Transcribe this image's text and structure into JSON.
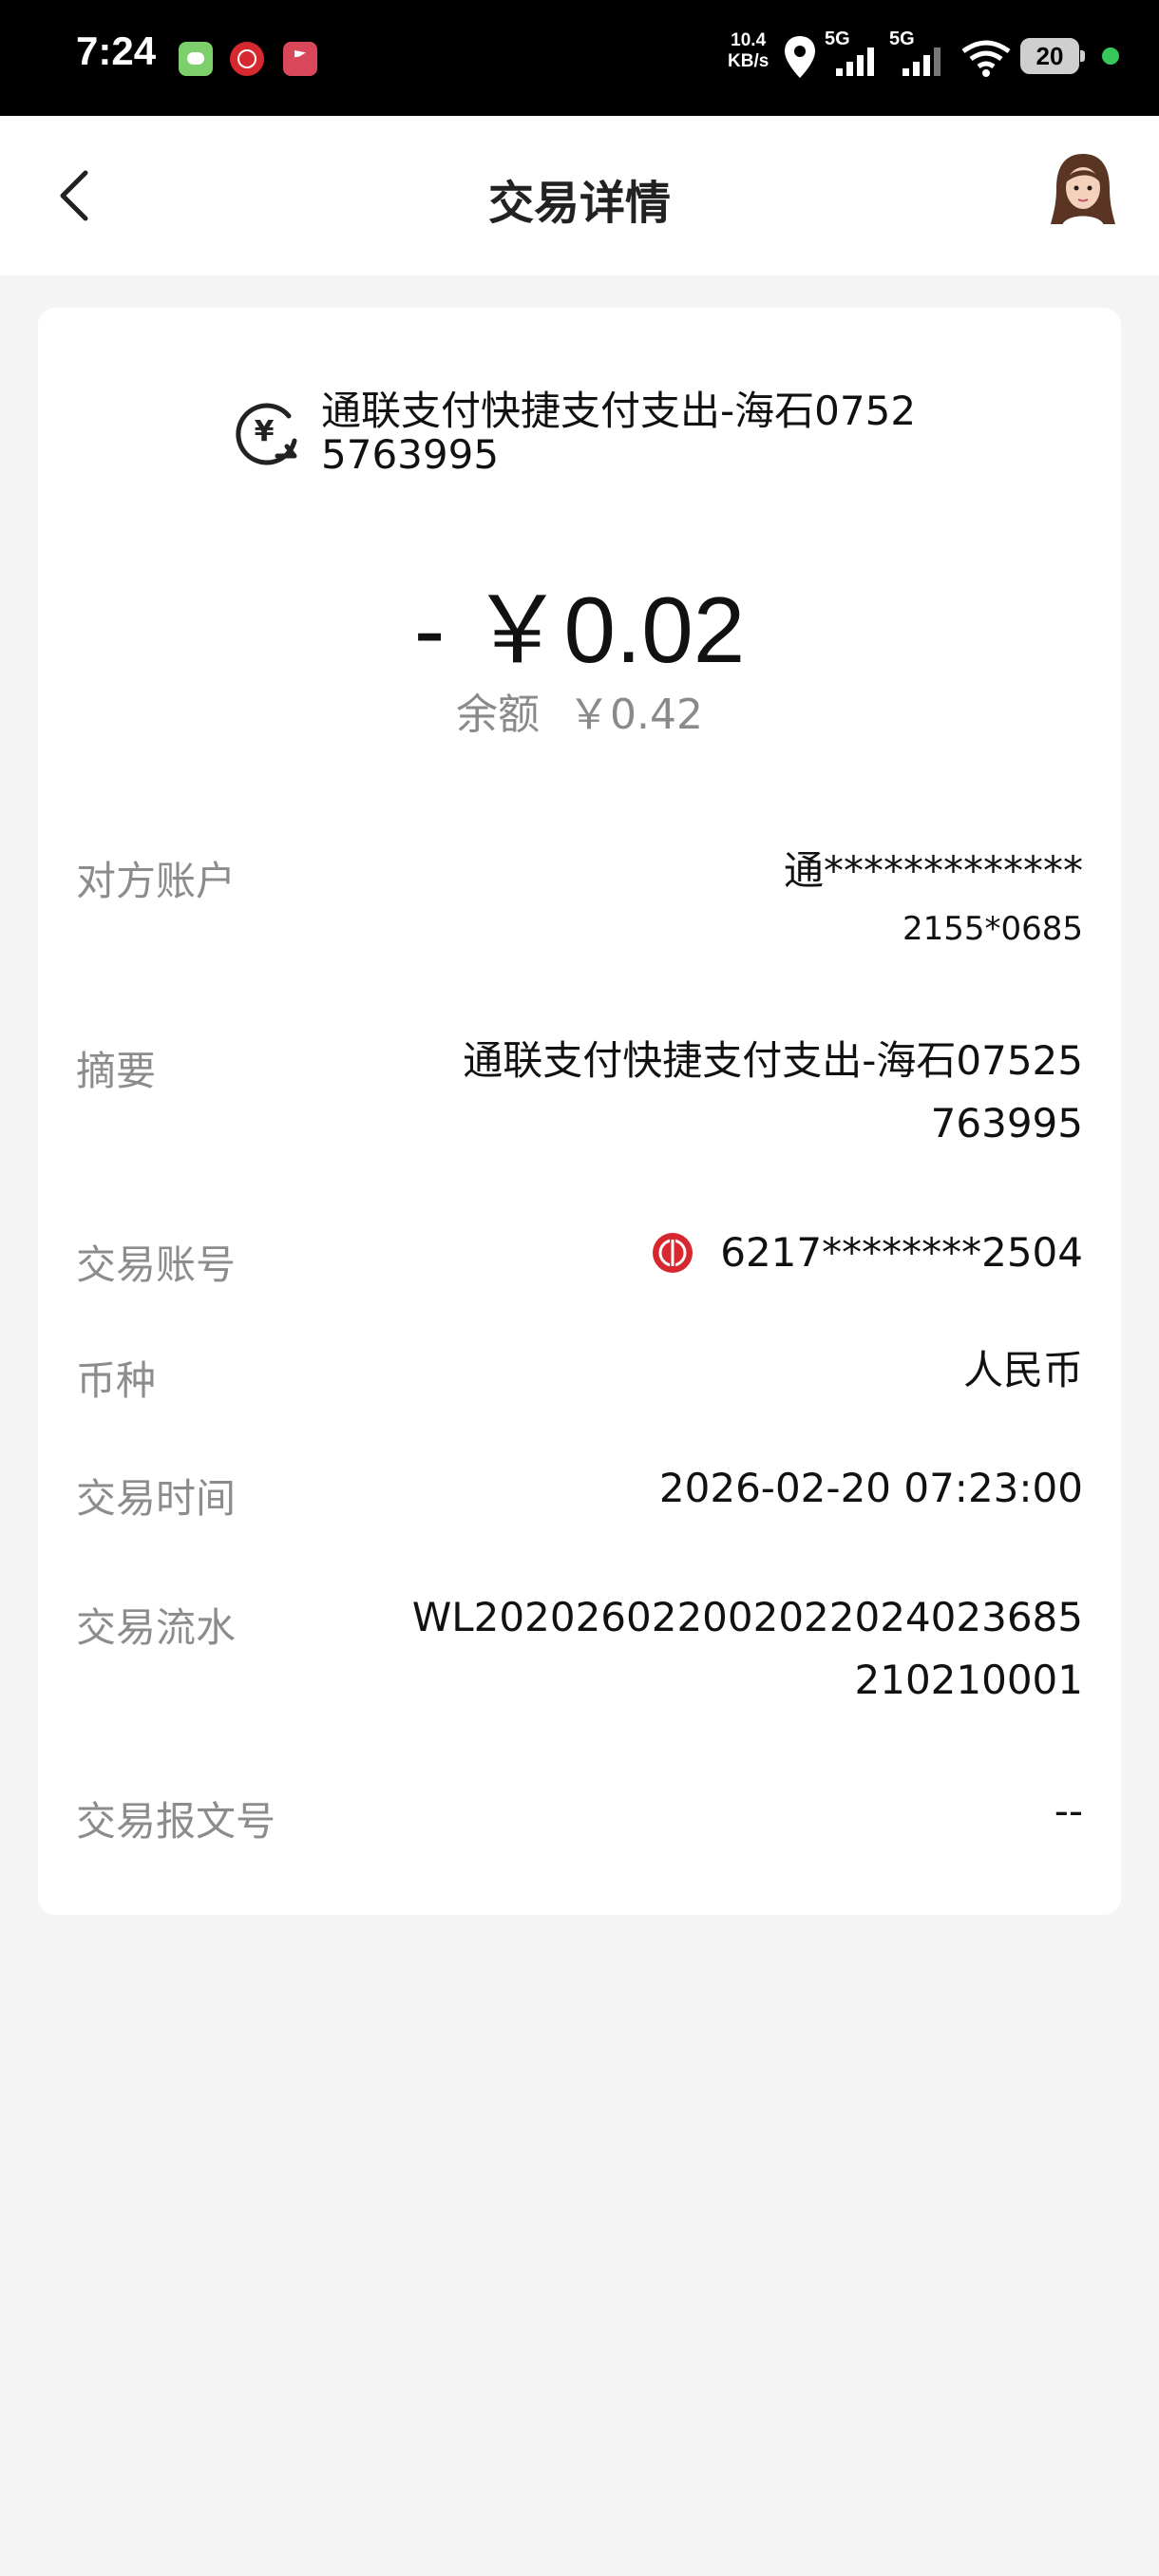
{
  "status_bar": {
    "time": "7:24",
    "net_speed_value": "10.4",
    "net_speed_unit": "KB/s",
    "signal1_label": "5G",
    "signal2_label": "5G",
    "battery": "20"
  },
  "nav": {
    "title": "交易详情"
  },
  "transaction": {
    "description": "通联支付快捷支付支出-海石07525763995",
    "amount": "- ￥0.02",
    "balance_label": "余额",
    "balance_value": "￥0.42"
  },
  "details": [
    {
      "label": "对方账户",
      "value_main": "通*************",
      "value_sub": "2155*0685"
    },
    {
      "label": "摘要",
      "value_line1": "通联支付快捷支付支出-海石07525",
      "value_line2": "763995"
    },
    {
      "label": "交易账号",
      "value": "6217********2504"
    },
    {
      "label": "币种",
      "value": "人民币"
    },
    {
      "label": "交易时间",
      "value": "2026-02-20 07:23:00"
    },
    {
      "label": "交易流水",
      "value_line1": "WL202026022002022024023685",
      "value_line2": "210210001"
    },
    {
      "label": "交易报文号",
      "value": "--"
    }
  ],
  "colors": {
    "bank_red": "#d8282f",
    "charge_green": "#35c759"
  }
}
